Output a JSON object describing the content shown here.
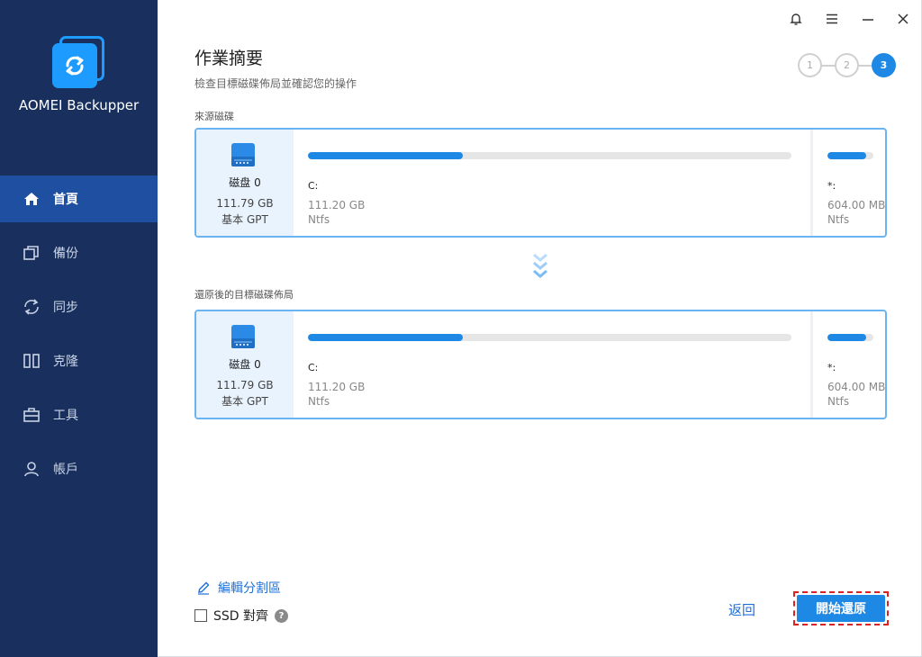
{
  "app": {
    "name": "AOMEI Backupper"
  },
  "sidebar": {
    "items": [
      {
        "label": "首頁",
        "icon": "home-icon",
        "active": true
      },
      {
        "label": "備份",
        "icon": "backup-icon",
        "active": false
      },
      {
        "label": "同步",
        "icon": "sync-icon",
        "active": false
      },
      {
        "label": "克隆",
        "icon": "clone-icon",
        "active": false
      },
      {
        "label": "工具",
        "icon": "toolbox-icon",
        "active": false
      },
      {
        "label": "帳戶",
        "icon": "user-icon",
        "active": false
      }
    ]
  },
  "header": {
    "title": "作業摘要",
    "subtitle": "檢查目標磁碟佈局並確認您的操作",
    "steps": [
      "1",
      "2",
      "3"
    ],
    "current_step": 3
  },
  "source": {
    "label": "來源磁碟",
    "disk": {
      "name": "磁盘 0",
      "size": "111.79 GB",
      "type": "基本 GPT"
    },
    "partitions": [
      {
        "letter": "C:",
        "size": "111.20 GB",
        "fs": "Ntfs",
        "used_fraction": 0.32
      },
      {
        "letter": "*:",
        "size": "604.00 MB",
        "fs": "Ntfs",
        "used_fraction": 0.85
      }
    ]
  },
  "target": {
    "label": "還原後的目標磁碟佈局",
    "disk": {
      "name": "磁盘 0",
      "size": "111.79 GB",
      "type": "基本 GPT"
    },
    "partitions": [
      {
        "letter": "C:",
        "size": "111.20 GB",
        "fs": "Ntfs",
        "used_fraction": 0.32
      },
      {
        "letter": "*:",
        "size": "604.00 MB",
        "fs": "Ntfs",
        "used_fraction": 0.85
      }
    ]
  },
  "bottom": {
    "edit_partitions": "編輯分割區",
    "ssd_align": "SSD 對齊",
    "help_glyph": "?",
    "back": "返回",
    "start_restore": "開始還原"
  },
  "colors": {
    "sidebar_bg": "#19305e",
    "accent": "#1e88e5",
    "active_nav": "#1f4fa0",
    "highlight_border": "#e02020"
  }
}
